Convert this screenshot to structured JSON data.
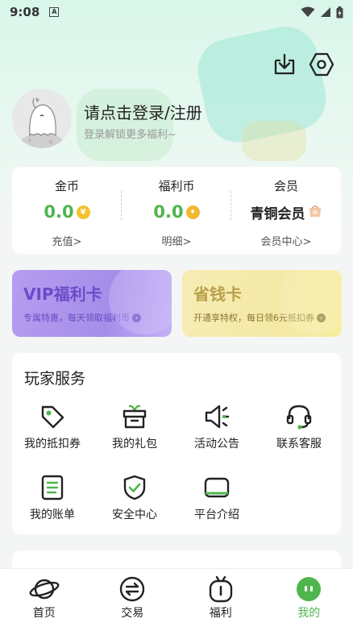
{
  "status_bar": {
    "time": "9:08",
    "notification_icon": "A"
  },
  "header": {
    "download_icon": "download-icon",
    "settings_icon": "settings-hex-icon",
    "login_title": "请点击登录/注册",
    "login_subtitle": "登录解锁更多福利~"
  },
  "wallet": {
    "gold": {
      "label": "金币",
      "value": "0.0",
      "link": "充值>"
    },
    "welfare": {
      "label": "福利币",
      "value": "0.0",
      "link": "明细>"
    },
    "member": {
      "label": "会员",
      "value": "青铜会员",
      "link": "会员中心>"
    }
  },
  "cards": {
    "vip": {
      "title": "VIP福利卡",
      "subtitle": "专属特惠，每天领取福利币"
    },
    "save": {
      "title": "省钱卡",
      "subtitle": "开通享特权，每日领6元抵扣券"
    }
  },
  "services": {
    "title": "玩家服务",
    "items": [
      {
        "label": "我的抵扣券",
        "icon": "tag-icon"
      },
      {
        "label": "我的礼包",
        "icon": "gift-icon"
      },
      {
        "label": "活动公告",
        "icon": "speaker-icon"
      },
      {
        "label": "联系客服",
        "icon": "headset-icon"
      },
      {
        "label": "我的账单",
        "icon": "bill-icon"
      },
      {
        "label": "安全中心",
        "icon": "shield-icon"
      },
      {
        "label": "平台介绍",
        "icon": "platform-icon"
      }
    ]
  },
  "tabbar": {
    "active": "我的",
    "accent": "#4fb54d",
    "tabs": [
      {
        "label": "首页",
        "icon": "planet-icon"
      },
      {
        "label": "交易",
        "icon": "exchange-icon"
      },
      {
        "label": "福利",
        "icon": "welfare-icon"
      },
      {
        "label": "我的",
        "icon": "profile-face-icon"
      }
    ]
  }
}
